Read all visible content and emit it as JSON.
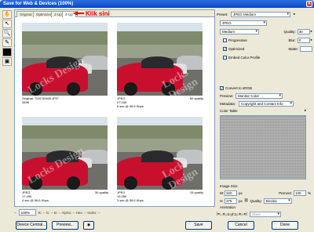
{
  "window": {
    "title": "Save for Web & Devices (100%)"
  },
  "toolbar": {
    "tools": [
      "hand-icon",
      "slice-select-icon",
      "zoom-icon",
      "eyedropper-icon",
      "color-swatch-icon",
      "slice-visibility-icon"
    ]
  },
  "tabs": [
    {
      "label": "Original",
      "active": false
    },
    {
      "label": "Optimized",
      "active": false
    },
    {
      "label": "2-Up",
      "active": false
    },
    {
      "label": "4-Up",
      "active": true
    }
  ],
  "annotation": {
    "text": "Klik sini"
  },
  "panels": [
    {
      "line1": "Original: \"DSC00465.JPG\"",
      "line2": "349K",
      "line3": "",
      "right1": "",
      "right2": ""
    },
    {
      "line1": "JPEG",
      "line2": "27.03K",
      "line3": "5 sec @ 56.6 Kbps",
      "right1": "50 quality",
      "right2": ""
    },
    {
      "line1": "JPEG",
      "line2": "17.49K",
      "line3": "4 sec @ 56.6 Kbps",
      "right1": "30 quality",
      "right2": ""
    },
    {
      "line1": "JPEG",
      "line2": "15.28K",
      "line3": "3 sec @ 56.6 Kbps",
      "right1": "15 quality",
      "right2": ""
    }
  ],
  "watermark": "Locks Design",
  "zoom": {
    "value": "100%"
  },
  "buttons": {
    "device_central": "Device Central...",
    "preview": "Preview...",
    "save": "Save",
    "cancel": "Cancel",
    "done": "Done"
  },
  "settings": {
    "preset_label": "Preset:",
    "preset_value": "JPEG Medium",
    "format_value": "JPEG",
    "compression_value": "Medium",
    "quality_label": "Quality:",
    "quality_value": "30",
    "progressive_label": "Progressive",
    "optimized_label": "Optimized",
    "icc_label": "Embed Color Profile",
    "blur_label": "Blur:",
    "blur_value": "0",
    "matte_label": "Matte:",
    "convert_label": "Convert to sRGB",
    "preview_label": "Preview:",
    "preview_value": "Monitor Color",
    "metadata_label": "Metadata:",
    "metadata_value": "Copyright and Contact Info",
    "color_table_label": "Color Table",
    "image_size_label": "Image Size",
    "w_label": "W:",
    "w_value": "320",
    "h_label": "H:",
    "h_value": "375",
    "px_label": "px",
    "percent_label": "Percent:",
    "percent_value": "100",
    "quality2_label": "Quality:",
    "quality2_value": "Bicubic",
    "animation_label": "Animation",
    "looping_label": "Looping Options:",
    "looping_value": "Once",
    "frame_counter": "1 of 1"
  },
  "colors": {
    "title_bar": "#0a47c7",
    "annotation": "#ee0000"
  }
}
